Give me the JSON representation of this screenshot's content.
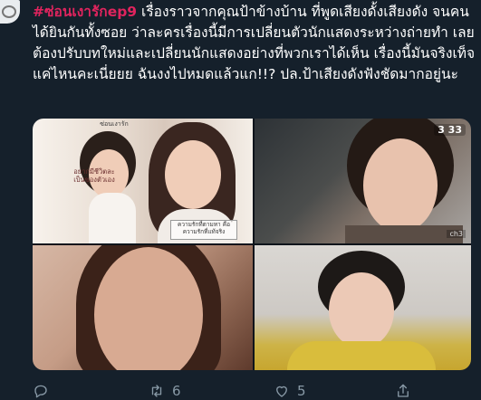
{
  "tweet": {
    "hashtag": "#ซ่อนเงารักep9",
    "text": " เรื่องราวจากคุณป้าข้างบ้าน ที่พูดเสียงดั้งเสียงดัง จนคนได้ยินกันทั้งซอย ว่าละครเรื่องนี้มีการเปลี่ยนตัวนักแสดงระหว่างถ่ายทำ เลยต้องปรับบทใหม่และเปลี่ยนนักแสดงอย่างที่พวกเราได้เห็น เรื่องนี้มันจริงเท็จแค่ไหนคะเนี่ยยย ฉันงงไปหมดแล้วแก!!? ปล.ป้าเสียงดังฟังชัดมากอยู่นะ"
  },
  "images": {
    "poster_top": "ซ่อนเงารัก",
    "poster_left": "อยากมีชีวิตละ เป็นของตัวเอง",
    "poster_bottom": "ความรักที่ตามหา คือความรักที่แท้จริง",
    "channel_badge": "3 33",
    "channel_tag": "ch3"
  },
  "actions": {
    "reply_count": "",
    "retweet_count": "6",
    "like_count": "5"
  },
  "colors": {
    "background": "#15202b",
    "hashtag": "#e0245e",
    "muted": "#8899a6"
  }
}
